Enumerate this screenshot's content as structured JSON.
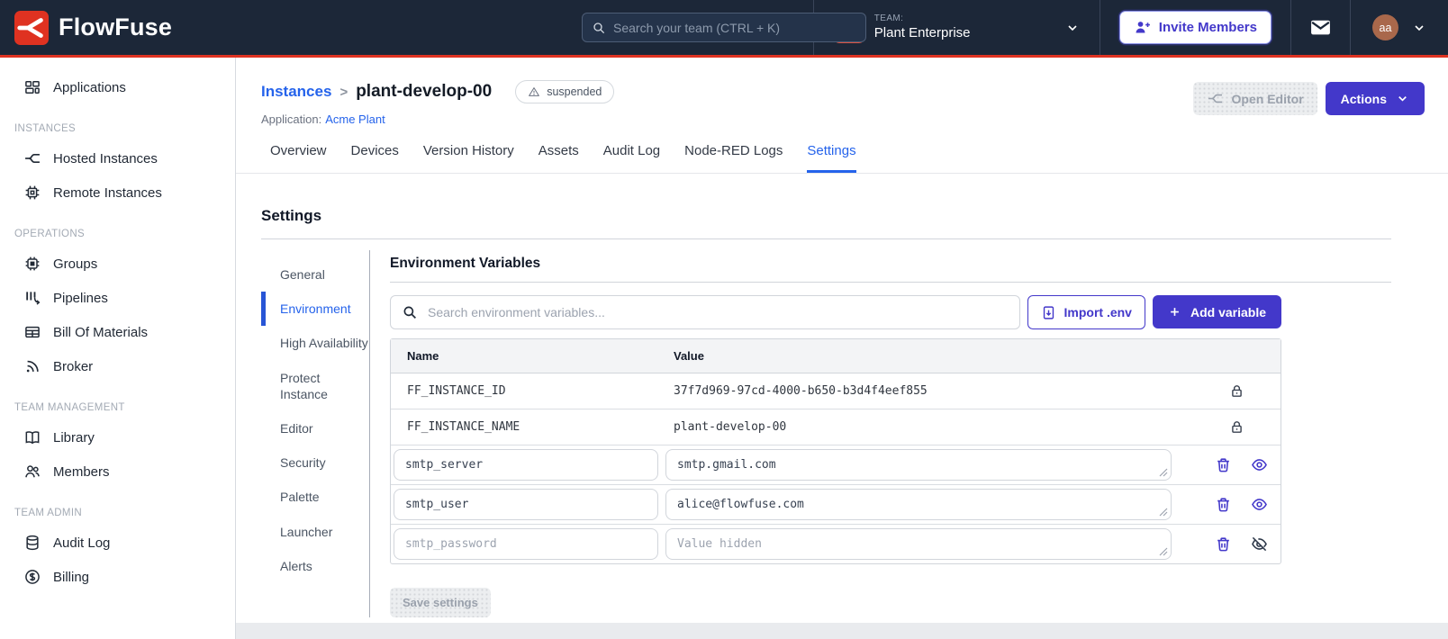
{
  "navbar": {
    "brand": "FlowFuse",
    "search_placeholder": "Search your team (CTRL + K)",
    "team_label": "TEAM:",
    "team_name": "Plant Enterprise",
    "invite_label": "Invite Members",
    "avatar_initials": "aa"
  },
  "sidebar": {
    "sections": [
      {
        "header": "",
        "items": [
          {
            "label": "Applications"
          }
        ]
      },
      {
        "header": "INSTANCES",
        "items": [
          {
            "label": "Hosted Instances"
          },
          {
            "label": "Remote Instances"
          }
        ]
      },
      {
        "header": "OPERATIONS",
        "items": [
          {
            "label": "Groups"
          },
          {
            "label": "Pipelines"
          },
          {
            "label": "Bill Of Materials"
          },
          {
            "label": "Broker"
          }
        ]
      },
      {
        "header": "TEAM MANAGEMENT",
        "items": [
          {
            "label": "Library"
          },
          {
            "label": "Members"
          }
        ]
      },
      {
        "header": "TEAM ADMIN",
        "items": [
          {
            "label": "Audit Log"
          },
          {
            "label": "Billing"
          }
        ]
      }
    ]
  },
  "header": {
    "breadcrumb_parent": "Instances",
    "breadcrumb_separator": ">",
    "instance_name": "plant-develop-00",
    "status": "suspended",
    "application_label": "Application:",
    "application_name": "Acme Plant",
    "open_editor_label": "Open Editor",
    "actions_label": "Actions"
  },
  "tabs": {
    "items": [
      "Overview",
      "Devices",
      "Version History",
      "Assets",
      "Audit Log",
      "Node-RED Logs",
      "Settings"
    ],
    "active": "Settings"
  },
  "settings": {
    "title": "Settings",
    "nav": [
      "General",
      "Environment",
      "High Availability",
      "Protect Instance",
      "Editor",
      "Security",
      "Palette",
      "Launcher",
      "Alerts"
    ],
    "active_nav": "Environment",
    "panel": {
      "title": "Environment Variables",
      "search_placeholder": "Search environment variables...",
      "import_label": "Import .env",
      "add_label": "Add variable",
      "table": {
        "columns": [
          "Name",
          "Value"
        ],
        "locked_rows": [
          {
            "name": "FF_INSTANCE_ID",
            "value": "37f7d969-97cd-4000-b650-b3d4f4eef855"
          },
          {
            "name": "FF_INSTANCE_NAME",
            "value": "plant-develop-00"
          }
        ],
        "editable_rows": [
          {
            "name": "smtp_server",
            "value": "smtp.gmail.com",
            "hidden": false
          },
          {
            "name": "smtp_user",
            "value": "alice@flowfuse.com",
            "hidden": false
          },
          {
            "name": "smtp_password",
            "value": "",
            "value_placeholder": "Value hidden",
            "hidden": true
          }
        ]
      },
      "save_label": "Save settings"
    }
  },
  "colors": {
    "navbar_bg": "#1c2738",
    "brand_red": "#df3221",
    "accent_indigo": "#4338ca",
    "link_blue": "#2563eb",
    "team_avatar": "#d95140",
    "user_avatar": "#a9684b"
  }
}
